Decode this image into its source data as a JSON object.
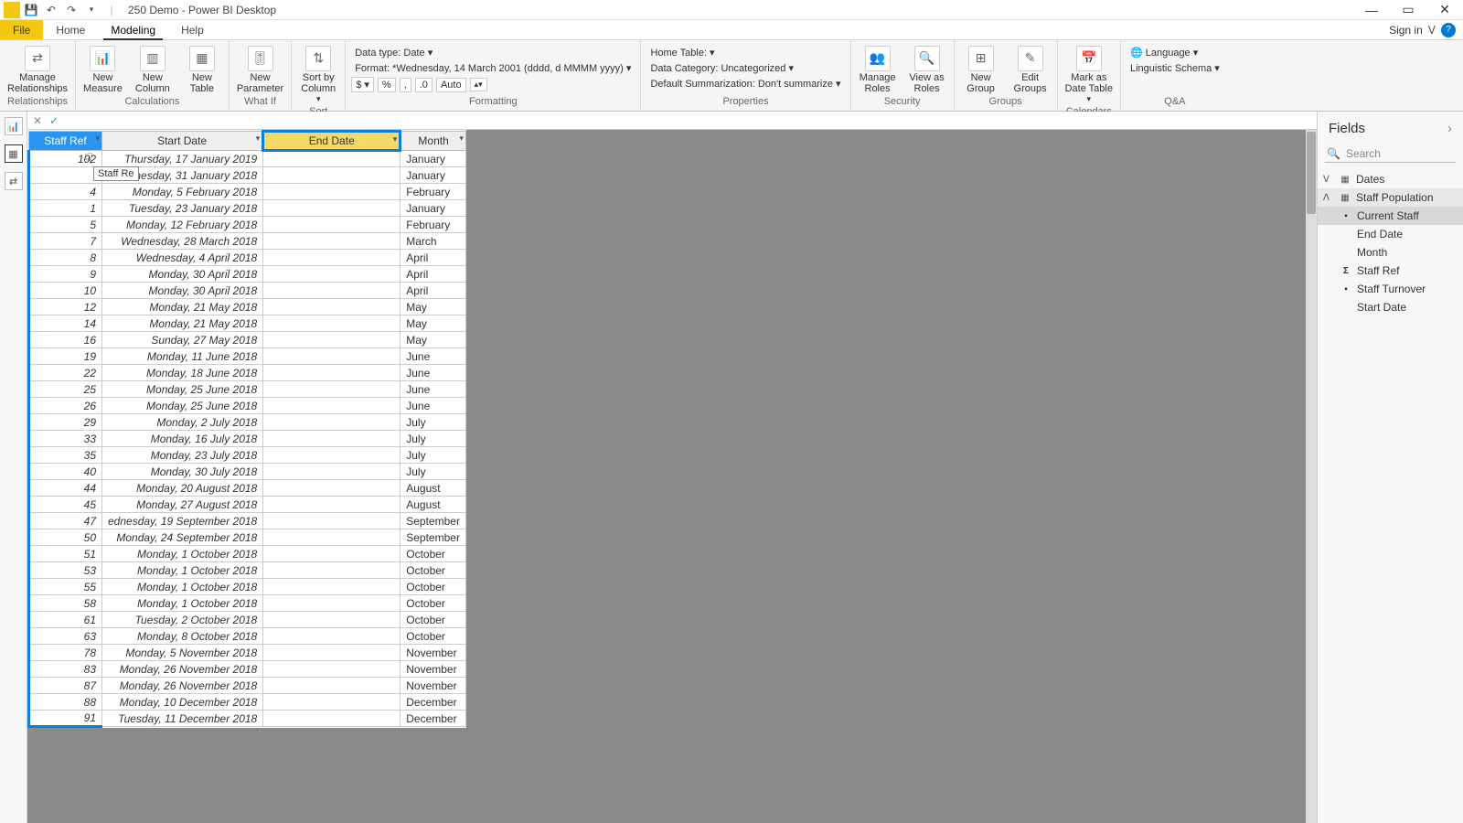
{
  "titlebar": {
    "title": "250 Demo - Power BI Desktop"
  },
  "signin": "Sign in",
  "tabs": {
    "file": "File",
    "home": "Home",
    "modeling": "Modeling",
    "help": "Help"
  },
  "ribbon": {
    "relationships": {
      "manage": "Manage\nRelationships",
      "group": "Relationships"
    },
    "calculations": {
      "measure": "New\nMeasure",
      "column": "New\nColumn",
      "table": "New\nTable",
      "group": "Calculations"
    },
    "whatif": {
      "param": "New\nParameter",
      "group": "What If"
    },
    "sort": {
      "sortby": "Sort by\nColumn",
      "group": "Sort"
    },
    "formatting": {
      "datatype": "Data type: Date",
      "format": "Format: *Wednesday, 14 March 2001 (dddd, d MMMM yyyy)",
      "auto": "Auto",
      "group": "Formatting"
    },
    "properties": {
      "hometable": "Home Table:",
      "category": "Data Category: Uncategorized",
      "summarization": "Default Summarization: Don't summarize",
      "group": "Properties"
    },
    "security": {
      "manageRoles": "Manage\nRoles",
      "viewAs": "View as\nRoles",
      "group": "Security"
    },
    "groups": {
      "new": "New\nGroup",
      "edit": "Edit\nGroups",
      "group": "Groups"
    },
    "calendars": {
      "mark": "Mark as\nDate Table",
      "group": "Calendars"
    },
    "qa": {
      "language": "Language",
      "schema": "Linguistic Schema",
      "group": "Q&A"
    }
  },
  "columns": {
    "staffRef": "Staff Ref",
    "startDate": "Start Date",
    "endDate": "End Date",
    "month": "Month"
  },
  "tooltip": "Staff Re",
  "rows": [
    {
      "ref": "102",
      "start": "Thursday, 17 January 2019",
      "end": "",
      "month": "January"
    },
    {
      "ref": "",
      "start": "Wednesday, 31 January 2018",
      "end": "",
      "month": "January"
    },
    {
      "ref": "4",
      "start": "Monday, 5 February 2018",
      "end": "",
      "month": "February"
    },
    {
      "ref": "1",
      "start": "Tuesday, 23 January 2018",
      "end": "",
      "month": "January"
    },
    {
      "ref": "5",
      "start": "Monday, 12 February 2018",
      "end": "",
      "month": "February"
    },
    {
      "ref": "7",
      "start": "Wednesday, 28 March 2018",
      "end": "",
      "month": "March"
    },
    {
      "ref": "8",
      "start": "Wednesday, 4 April 2018",
      "end": "",
      "month": "April"
    },
    {
      "ref": "9",
      "start": "Monday, 30 April 2018",
      "end": "",
      "month": "April"
    },
    {
      "ref": "10",
      "start": "Monday, 30 April 2018",
      "end": "",
      "month": "April"
    },
    {
      "ref": "12",
      "start": "Monday, 21 May 2018",
      "end": "",
      "month": "May"
    },
    {
      "ref": "14",
      "start": "Monday, 21 May 2018",
      "end": "",
      "month": "May"
    },
    {
      "ref": "16",
      "start": "Sunday, 27 May 2018",
      "end": "",
      "month": "May"
    },
    {
      "ref": "19",
      "start": "Monday, 11 June 2018",
      "end": "",
      "month": "June"
    },
    {
      "ref": "22",
      "start": "Monday, 18 June 2018",
      "end": "",
      "month": "June"
    },
    {
      "ref": "25",
      "start": "Monday, 25 June 2018",
      "end": "",
      "month": "June"
    },
    {
      "ref": "26",
      "start": "Monday, 25 June 2018",
      "end": "",
      "month": "June"
    },
    {
      "ref": "29",
      "start": "Monday, 2 July 2018",
      "end": "",
      "month": "July"
    },
    {
      "ref": "33",
      "start": "Monday, 16 July 2018",
      "end": "",
      "month": "July"
    },
    {
      "ref": "35",
      "start": "Monday, 23 July 2018",
      "end": "",
      "month": "July"
    },
    {
      "ref": "40",
      "start": "Monday, 30 July 2018",
      "end": "",
      "month": "July"
    },
    {
      "ref": "44",
      "start": "Monday, 20 August 2018",
      "end": "",
      "month": "August"
    },
    {
      "ref": "45",
      "start": "Monday, 27 August 2018",
      "end": "",
      "month": "August"
    },
    {
      "ref": "47",
      "start": "ednesday, 19 September 2018",
      "end": "",
      "month": "September"
    },
    {
      "ref": "50",
      "start": "Monday, 24 September 2018",
      "end": "",
      "month": "September"
    },
    {
      "ref": "51",
      "start": "Monday, 1 October 2018",
      "end": "",
      "month": "October"
    },
    {
      "ref": "53",
      "start": "Monday, 1 October 2018",
      "end": "",
      "month": "October"
    },
    {
      "ref": "55",
      "start": "Monday, 1 October 2018",
      "end": "",
      "month": "October"
    },
    {
      "ref": "58",
      "start": "Monday, 1 October 2018",
      "end": "",
      "month": "October"
    },
    {
      "ref": "61",
      "start": "Tuesday, 2 October 2018",
      "end": "",
      "month": "October"
    },
    {
      "ref": "63",
      "start": "Monday, 8 October 2018",
      "end": "",
      "month": "October"
    },
    {
      "ref": "78",
      "start": "Monday, 5 November 2018",
      "end": "",
      "month": "November"
    },
    {
      "ref": "83",
      "start": "Monday, 26 November 2018",
      "end": "",
      "month": "November"
    },
    {
      "ref": "87",
      "start": "Monday, 26 November 2018",
      "end": "",
      "month": "November"
    },
    {
      "ref": "88",
      "start": "Monday, 10 December 2018",
      "end": "",
      "month": "December"
    },
    {
      "ref": "91",
      "start": "Tuesday, 11 December 2018",
      "end": "",
      "month": "December"
    }
  ],
  "fields": {
    "title": "Fields",
    "search": "Search",
    "tables": {
      "dates": "Dates",
      "staffPop": "Staff Population",
      "items": {
        "currentStaff": "Current Staff",
        "endDate": "End Date",
        "month": "Month",
        "staffRef": "Staff Ref",
        "staffTurnover": "Staff Turnover",
        "startDate": "Start Date"
      }
    }
  }
}
